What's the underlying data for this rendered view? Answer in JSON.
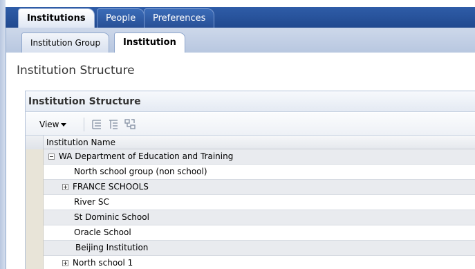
{
  "main_tabs": [
    {
      "label": "Institutions",
      "active": true
    },
    {
      "label": "People",
      "active": false
    },
    {
      "label": "Preferences",
      "active": false
    }
  ],
  "sub_tabs": [
    {
      "label": "Institution Group",
      "active": false
    },
    {
      "label": "Institution",
      "active": true
    }
  ],
  "page_heading": "Institution Structure",
  "section": {
    "title": "Institution Structure",
    "toolbar": {
      "view_label": "View",
      "icons": [
        "expand-all-icon",
        "collapse-all-icon",
        "hierarchy-icon"
      ]
    },
    "table": {
      "column_header": "Institution Name",
      "rows": [
        {
          "name": "WA Department of Education and Training",
          "expander": "minus",
          "level": 0
        },
        {
          "name": "North school group (non school)",
          "expander": "none",
          "level": 1
        },
        {
          "name": "FRANCE SCHOOLS",
          "expander": "plus",
          "level": 1
        },
        {
          "name": "River SC",
          "expander": "none",
          "level": 1
        },
        {
          "name": "St Dominic School",
          "expander": "none",
          "level": 1
        },
        {
          "name": "Oracle School",
          "expander": "none",
          "level": 1
        },
        {
          "name": "Beijing Institution",
          "expander": "none",
          "level": 1
        },
        {
          "name": "North school 1",
          "expander": "plus",
          "level": 1
        }
      ]
    }
  },
  "colors": {
    "tab_bar_blue": "#21498f",
    "row_alt": "#e9ebef",
    "gutter": "#e8e4d8"
  }
}
